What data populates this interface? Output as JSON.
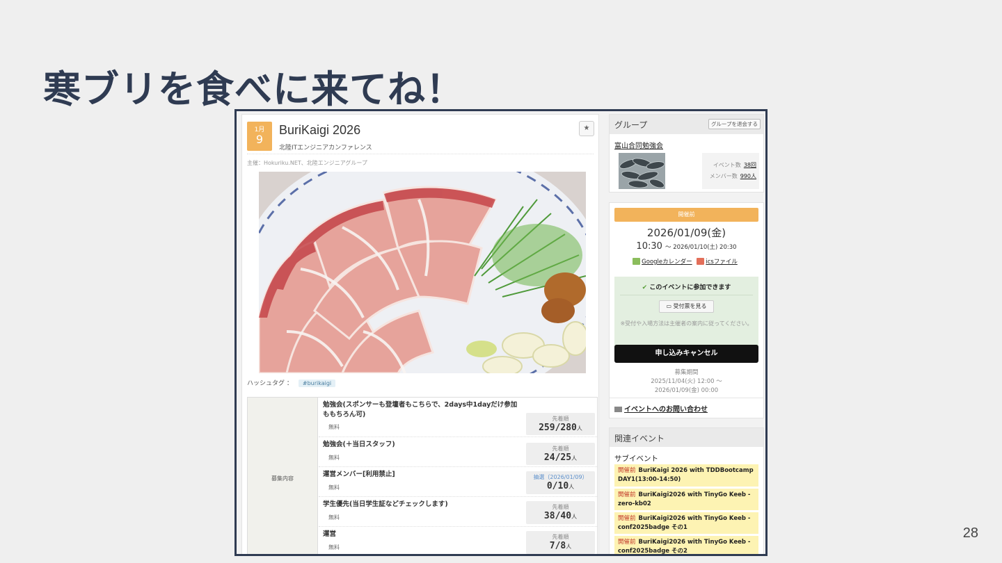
{
  "slide": {
    "title": "寒ブリを食べに来てね！",
    "page_number": "28"
  },
  "event": {
    "month": "1月",
    "day": "9",
    "title": "BuriKaigi 2026",
    "subtitle": "北陸ITエンジニアカンファレンス",
    "organizer": "主催：Hokuriku.NET、北陸エンジニアグループ",
    "hashtag_label": "ハッシュタグ ：",
    "hashtag": "#burikaigi"
  },
  "tickets": {
    "label": "募集内容",
    "rows": [
      {
        "name": "勉強会(スポンサーも登壇者もこちらで、2days中1dayだけ参加ももちろん可)",
        "price": "無料",
        "kind": "先着順",
        "count": "259/280",
        "unit": "人"
      },
      {
        "name": "勉強会(＋当日スタッフ)",
        "price": "無料",
        "kind": "先着順",
        "count": "24/25",
        "unit": "人"
      },
      {
        "name": "運営メンバー[利用禁止]",
        "price": "無料",
        "kind": "抽選（2026/01/09）",
        "count": "0/10",
        "unit": "人"
      },
      {
        "name": "学生優先(当日学生証などチェックします)",
        "price": "無料",
        "kind": "先着順",
        "count": "38/40",
        "unit": "人"
      },
      {
        "name": "運営",
        "price": "無料",
        "kind": "先着順",
        "count": "7/8",
        "unit": "人"
      }
    ]
  },
  "group": {
    "header": "グループ",
    "withdraw": "グループを退会する",
    "name": "富山合同勉強会",
    "events_label": "イベント数",
    "events_value": "38回",
    "members_label": "メンバー数",
    "members_value": "990人"
  },
  "schedule": {
    "status": "開催前",
    "date": "2026/01/09(金)",
    "start": "10:30",
    "end": "～ 2026/01/10(土) 20:30",
    "google_cal": "Googleカレンダー",
    "ics": "icsファイル"
  },
  "join": {
    "title": "このイベントに参加できます",
    "ticket_button": "受付票を見る",
    "note": "※受付や入場方法は主催者の案内に従ってください。",
    "cancel": "申し込みキャンセル",
    "period_label": "募集期間",
    "period_start": "2025/11/04(火) 12:00 ～",
    "period_end": "2026/01/09(金) 00:00",
    "contact": "イベントへのお問い合わせ"
  },
  "related": {
    "header": "関連イベント",
    "sub": "サブイベント",
    "items": [
      {
        "status": "開催前",
        "title": "BuriKaigi 2026 with TDDBootcamp DAY1(13:00-14:50)"
      },
      {
        "status": "開催前",
        "title": "BuriKaigi2026 with TinyGo Keeb - zero-kb02"
      },
      {
        "status": "開催前",
        "title": "BuriKaigi2026 with TinyGo Keeb - conf2025badge その1"
      },
      {
        "status": "開催前",
        "title": "BuriKaigi2026 with TinyGo Keeb - conf2025badge その2"
      }
    ]
  },
  "colors": {
    "title": "#2f3b52",
    "accent": "#f2b35b",
    "ok_bg": "#e3efe0",
    "related_bg": "#fdf3b3"
  }
}
